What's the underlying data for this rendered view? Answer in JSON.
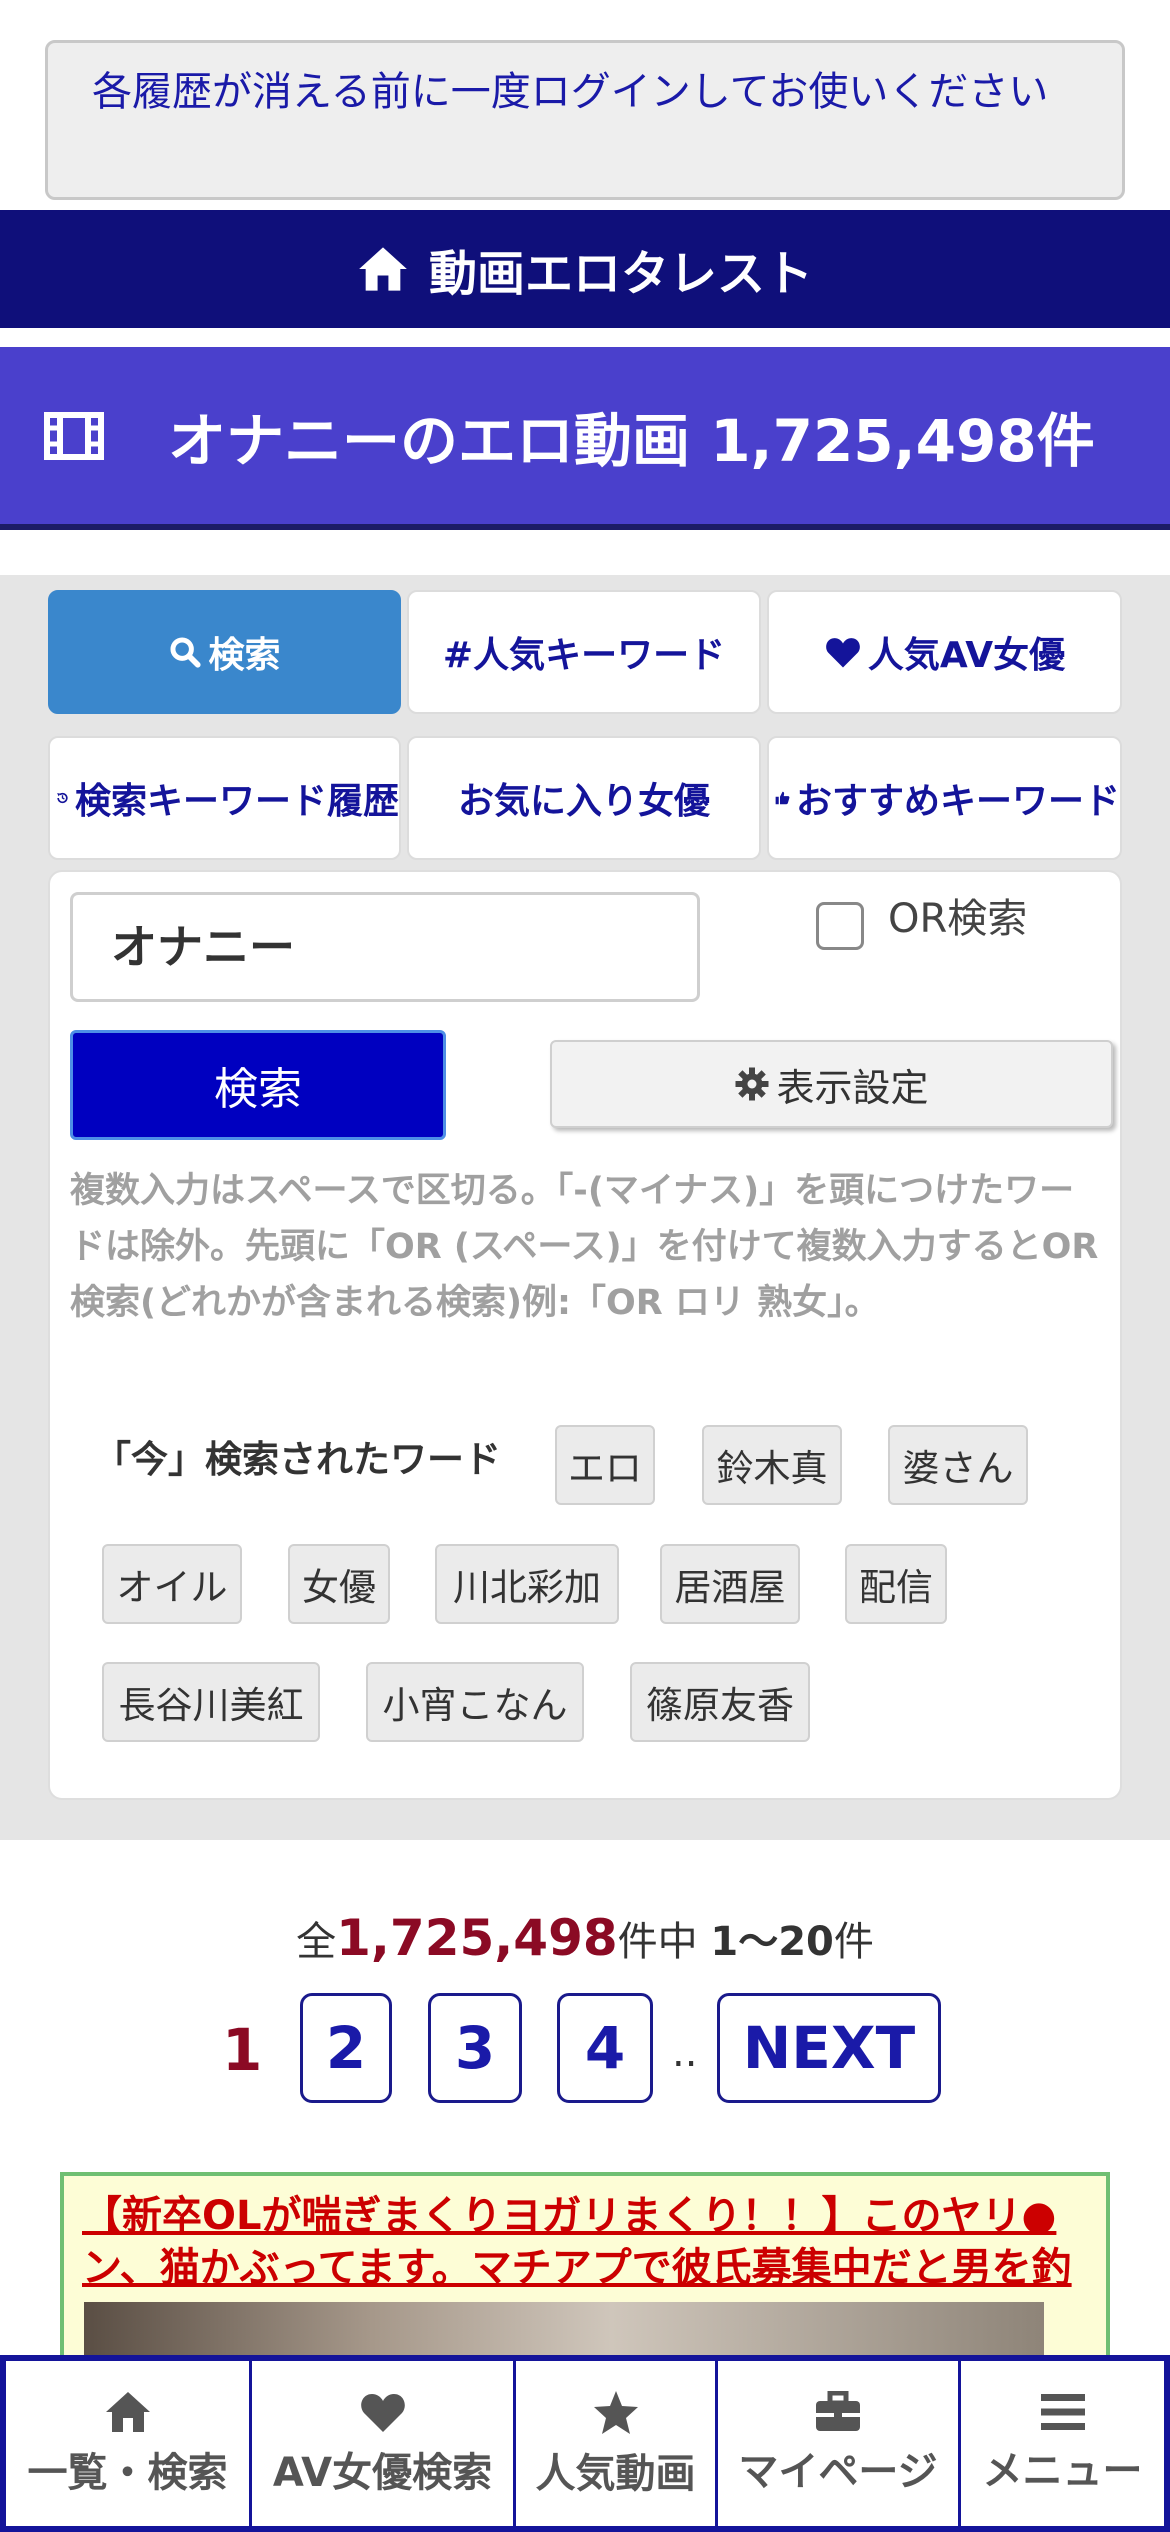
{
  "notice": {
    "text": "各履歴が消える前に一度ログインしてお使いください"
  },
  "header": {
    "title": "動画エロタレスト",
    "icon": "home-icon"
  },
  "page_title": {
    "text": "オナニーのエロ動画 1,725,498件",
    "icon": "film-icon"
  },
  "tabs": [
    {
      "label": "検索",
      "icon": "search-icon",
      "active": true
    },
    {
      "label": "#人気キーワード",
      "icon": "",
      "active": false
    },
    {
      "label": "人気AV女優",
      "icon": "heart-icon",
      "active": false
    },
    {
      "label": "検索キーワード履歴",
      "icon": "history-icon",
      "active": false
    },
    {
      "label": "お気に入り女優",
      "icon": "",
      "active": false
    },
    {
      "label": "おすすめキーワード",
      "icon": "thumbs-up-icon",
      "active": false
    }
  ],
  "search": {
    "value": "オナニー",
    "or_label": "OR検索",
    "or_checked": false,
    "submit_label": "検索",
    "display_settings_label": "表示設定",
    "help_text": "複数入力はスペースで区切る。「-(マイナス)」を頭につけたワードは除外。先頭に「OR (スペース)」を付けて複数入力するとOR検索(どれかが含まれる検索)例:「OR ロリ 熟女」。"
  },
  "trending": {
    "label": "「今」検索されたワード",
    "words": [
      "エロ",
      "鈴木真",
      "婆さん",
      "オイル",
      "女優",
      "川北彩加",
      "居酒屋",
      "配信",
      "長谷川美紅",
      "小宵こなん",
      "篠原友香"
    ]
  },
  "results": {
    "prefix": "全",
    "total": "1,725,498",
    "mid": "件中",
    "range": "1〜20",
    "suffix": "件"
  },
  "pagination": {
    "current": "1",
    "pages": [
      "2",
      "3",
      "4"
    ],
    "dots": "..",
    "next": "NEXT"
  },
  "ad": {
    "text": "【新卒OLが喘ぎまくりヨガリまくり！！】このヤリ●ン、猫かぶってます。マチアプで彼氏募集中だと男を釣"
  },
  "bottom_nav": [
    {
      "label": "一覧・検索",
      "icon": "home-icon"
    },
    {
      "label": "AV女優検索",
      "icon": "heart-icon"
    },
    {
      "label": "人気動画",
      "icon": "star-icon"
    },
    {
      "label": "マイページ",
      "icon": "briefcase-icon"
    },
    {
      "label": "メニュー",
      "icon": "menu-icon"
    }
  ],
  "colors": {
    "header": "#0f0f7a",
    "title_bar": "#4a40cc",
    "active_tab": "#3a87cc",
    "search_button": "#0000c0",
    "count_accent": "#8b0a24"
  }
}
